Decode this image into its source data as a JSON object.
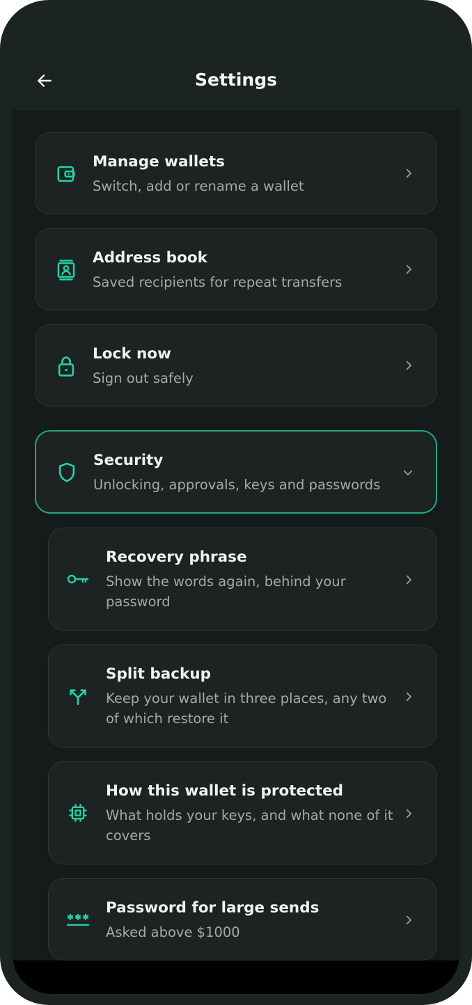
{
  "header": {
    "title": "Settings"
  },
  "menu": [
    {
      "title": "Manage wallets",
      "subtitle": "Switch, add or rename a wallet",
      "icon": "wallet-icon"
    },
    {
      "title": "Address book",
      "subtitle": "Saved recipients for repeat transfers",
      "icon": "contact-book-icon"
    },
    {
      "title": "Lock now",
      "subtitle": "Sign out safely",
      "icon": "lock-icon"
    }
  ],
  "security": {
    "title": "Security",
    "subtitle": "Unlocking, approvals, keys and passwords",
    "icon": "shield-icon",
    "expanded": true,
    "items": [
      {
        "title": "Recovery phrase",
        "subtitle": "Show the words again, behind your password",
        "icon": "key-icon"
      },
      {
        "title": "Split backup",
        "subtitle": "Keep your wallet in three places, any two of which restore it",
        "icon": "split-icon"
      },
      {
        "title": "How this wallet is protected",
        "subtitle": "What holds your keys, and what none of it covers",
        "icon": "chip-icon"
      },
      {
        "title": "Password for large sends",
        "subtitle": "Asked above $1000",
        "icon": "password-icon"
      }
    ]
  },
  "colors": {
    "accent": "#23d3a3",
    "background": "#141b1a",
    "card": "#1c2322",
    "border": "#2e3836",
    "expanded_border": "#1fa884"
  }
}
